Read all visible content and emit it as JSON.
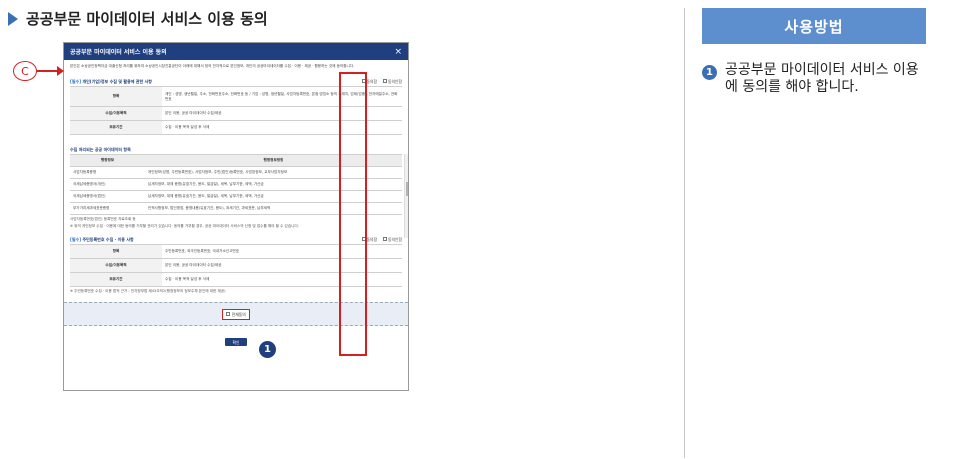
{
  "heading": {
    "title": "공공부문 마이데이터 서비스 이용 동의"
  },
  "usage": {
    "header": "사용방법",
    "steps": [
      {
        "num": "1",
        "text": "공공부문 마이데이터 서비스 이용에 동의를 해야 합니다."
      }
    ]
  },
  "modal": {
    "title": "공공부문 마이데이터 서비스 이용 동의",
    "close": "×",
    "intro": "본인은 소상공인정책자금 대출신청 처리를 위하여 소상공인시장진흥공단이 아래에 대해서 정의 전자적으로 본인정보, 개인의 공공마이데이터를 수집 · 이용 · 제공 · 활용하는 것에 동의합니다.",
    "section1": {
      "tag": "[필수]",
      "title": "개인(기업)정보 수집 및 활용에 관한 사항",
      "agree": "동의함",
      "disagree": "동의안함",
      "rows": [
        {
          "label": "항목",
          "value": "개인 : 성명, 생년월일, 주소, 전화번호주소, 전화번호 등 / 기업 : 성명, 생년월일, 사업자등록번호, 본점 영업소 등의 소재지, 업태(업종), 전자메일주소, 전화번호"
        },
        {
          "label": "수집/이용목적",
          "value": "본인 이용, 공공 마이데이터 수집/제공"
        },
        {
          "label": "보유기간",
          "value": "수집 · 이용 목적 달성 후 삭제"
        }
      ]
    },
    "section2": {
      "title": "수집 처리되는 공공 마이데이터 항목",
      "headers": [
        "행정정보",
        "행정정보명칭"
      ],
      "rows": [
        {
          "name": "사업자등록증명",
          "desc": "개인정보(성명, 주민등록번호), 사업자정보, 주민(법인)등록번호, 사업장정보, 교부사업자정보"
        },
        {
          "name": "국세납세증명서(개인)",
          "desc": "납세자정보, 대체 증명(유효기간, 용도, 발급일), 세목, 납부기한, 세액, 가산금"
        },
        {
          "name": "국세납세증명서(법인)",
          "desc": "납세자정보, 대체 증명(유효기간, 용도, 발급일), 세목, 납부기한, 세액, 가산금"
        },
        {
          "name": "부가가치세과세표준증명",
          "desc": "인적사항정보, 법인명칭, 증명내용(유효기간, 용도), 과세기간, 과세표준, 납부세액"
        }
      ],
      "note_small": "사업자등록번호(법인) 등록번호 자료조회 등",
      "note": "※ 위의 개인정보 수집 · 이용에 대한 동의를 거부할 권리가 있습니다. 동의를 거부할 경우, 공공 마이데이터 서비스의 신청 및 접수를 해야 할 수 있습니다."
    },
    "section3": {
      "tag": "[필수]",
      "title": "주민등록번호 수집 · 이용 사항",
      "agree": "동의함",
      "disagree": "동의안함",
      "rows": [
        {
          "label": "항목",
          "value": "주민등록번호, 외국인등록번호, 국내거소신고번호"
        },
        {
          "label": "수집/이용목적",
          "value": "본인 이용, 공공 마이데이터 수집/제공"
        },
        {
          "label": "보유기간",
          "value": "수집 · 이용 목적 달성 후 삭제"
        }
      ],
      "note": "※ 주민등록번호 수집 · 이용 법적 근거 : 전자정부법 제43조의2(행정정보의 정보주체 본인에 대한 제공)"
    },
    "agree_all": "전체동의",
    "ok": "확인"
  },
  "annotations": {
    "callout_c": "C",
    "badge_1": "1"
  },
  "colors": {
    "accent": "#1f3f7f",
    "highlight": "#d42020",
    "usage_header": "#5d8fcf"
  }
}
